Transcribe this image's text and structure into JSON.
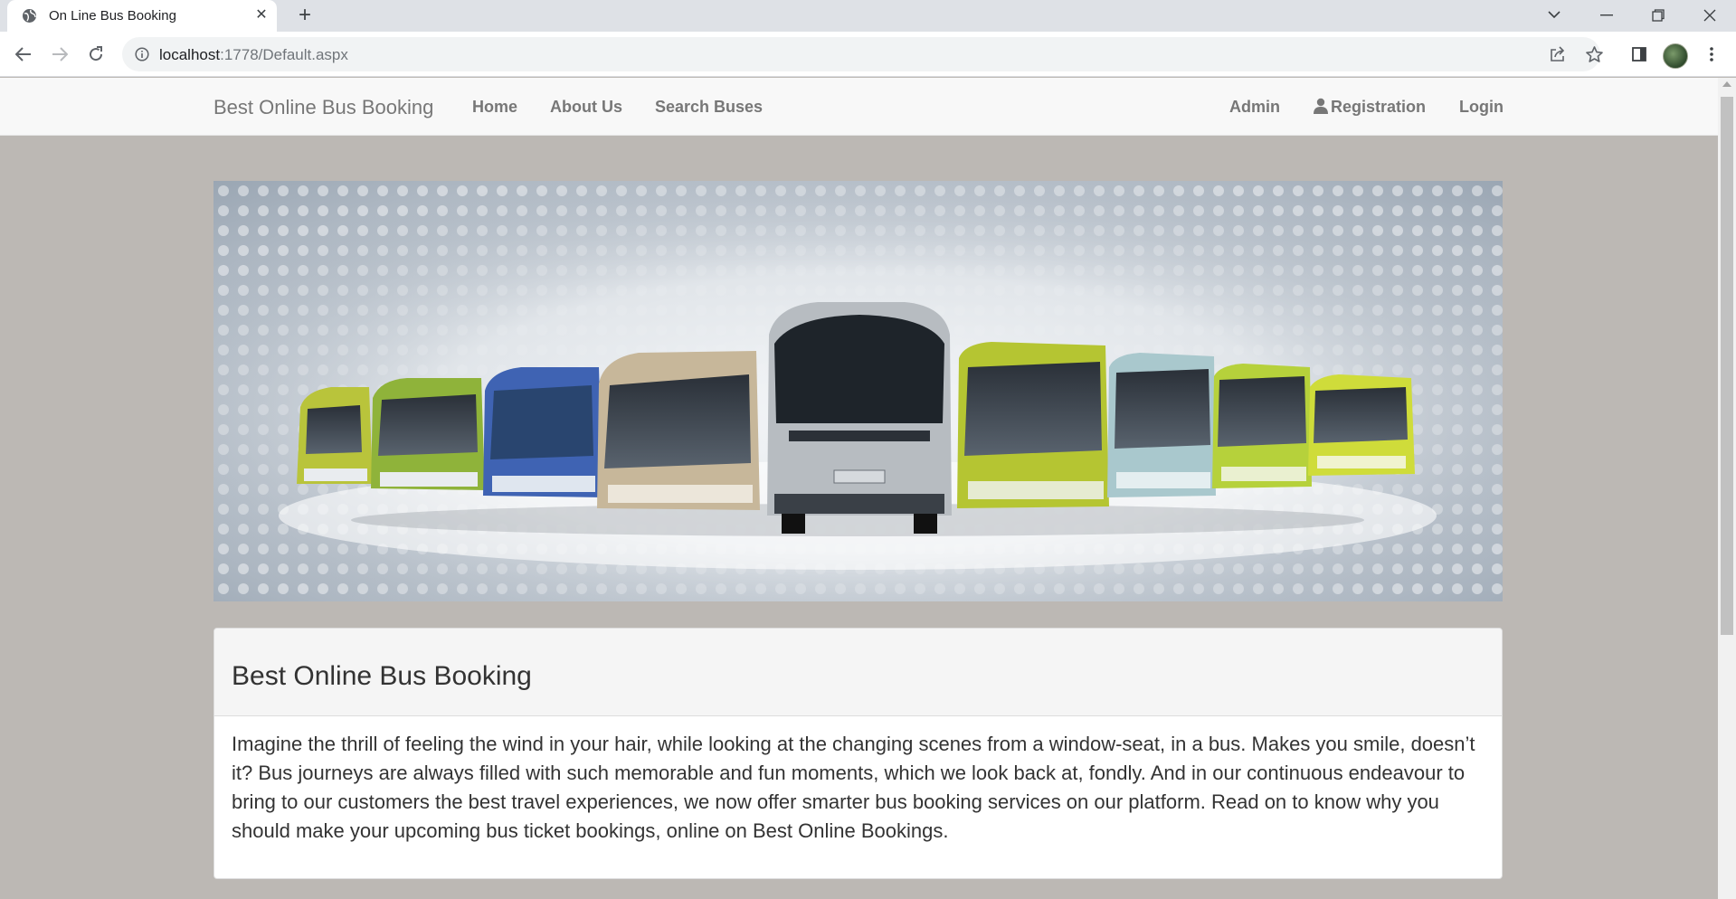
{
  "browser": {
    "tab_title": "On Line Bus Booking",
    "url_host": "localhost",
    "url_path": ":1778/Default.aspx"
  },
  "site": {
    "brand": "Best Online Bus Booking",
    "nav_left": [
      "Home",
      "About Us",
      "Search Buses"
    ],
    "nav_right": {
      "admin": "Admin",
      "registration": "Registration",
      "login": "Login"
    }
  },
  "panel": {
    "heading": "Best Online Bus Booking",
    "body": "Imagine the thrill of feeling the wind in your hair, while looking at the changing scenes from a window-seat, in a bus. Makes you smile, doesn’t it? Bus journeys are always filled with such memorable and fun moments, which we look back at, fondly. And in our continuous endeavour to bring to our customers the best travel experiences, we now offer smarter bus booking services on our platform. Read on to know why you should make your upcoming bus ticket bookings, online on Best Online Bookings."
  },
  "colors": {
    "page_bg": "#bcb8b4",
    "navbar_bg": "#f8f8f8",
    "nav_text": "#777777",
    "panel_head_bg": "#f5f5f5"
  }
}
